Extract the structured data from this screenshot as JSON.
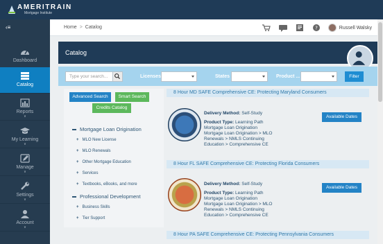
{
  "brand": {
    "name": "AMERITRAIN",
    "tagline": "Mortgage Institute"
  },
  "breadcrumb": {
    "home": "Home",
    "separator": ">",
    "current": "Catalog"
  },
  "header": {
    "notifications": [
      {
        "icon": "cart-icon",
        "badge": ""
      },
      {
        "icon": "message-icon",
        "badge": ""
      },
      {
        "icon": "notes-icon",
        "badge": ""
      },
      {
        "icon": "help-icon",
        "badge": ""
      }
    ],
    "user_name": "Russell Walsky"
  },
  "sidebar": {
    "items": [
      {
        "label": "Dashboard",
        "icon": "dashboard-icon",
        "active": false
      },
      {
        "label": "Catalog",
        "icon": "catalog-icon",
        "active": true
      },
      {
        "label": "Reports",
        "icon": "reports-icon",
        "active": false
      },
      {
        "label": "My Learning",
        "icon": "graduation-cap-icon",
        "active": false
      },
      {
        "label": "Manage",
        "icon": "edit-icon",
        "active": false
      },
      {
        "label": "Settings",
        "icon": "wrench-icon",
        "active": false
      },
      {
        "label": "Account",
        "icon": "user-icon",
        "active": false
      }
    ]
  },
  "page": {
    "title": "Catalog"
  },
  "filters": {
    "search_placeholder": "Type your search...",
    "licenses_label": "Licenses",
    "states_label": "States",
    "product_label": "Product ...",
    "filter_button": "Filter"
  },
  "left_panel": {
    "advanced_search": "Advanced Search",
    "smart_search": "Smart Search",
    "credits_catalog": "Credits Catalog",
    "categories": [
      {
        "label": "Mortgage Loan Origination",
        "children": [
          "MLO New License",
          "MLO Renewals",
          "Other Mortgage Education",
          "Services",
          "Textbooks, eBooks, and more"
        ]
      },
      {
        "label": "Professional Development",
        "children": [
          "Business Skills",
          "Tier Support"
        ]
      }
    ]
  },
  "courses": [
    {
      "title": "8 Hour MD SAFE Comprehensive CE: Protecting Maryland Consumers",
      "delivery_label": "Delivery Method:",
      "delivery": "Self-Study",
      "product_label": "Product Type:",
      "product_type": "Learning Path",
      "categories": [
        "Mortgage Loan Origination",
        "Mortgage Loan Origination > MLO",
        "Renewals > NMLS Continuing",
        "Education > Comprehensive CE"
      ],
      "button": "Available Dates"
    },
    {
      "title": "8 Hour FL SAFE Comprehensive CE: Protecting Florida Consumers",
      "delivery_label": "Delivery Method:",
      "delivery": "Self-Study",
      "product_label": "Product Type:",
      "product_type": "Learning Path",
      "categories": [
        "Mortgage Loan Origination",
        "Mortgage Loan Origination > MLO",
        "Renewals > NMLS Continuing",
        "Education > Comprehensive CE"
      ],
      "button": "Available Dates"
    },
    {
      "title": "8 Hour PA SAFE Comprehensive CE: Protecting Pennsylvania Consumers"
    }
  ],
  "colors": {
    "header": "#1f3b57",
    "accent": "#2383c6",
    "green": "#5cb85c",
    "active_nav": "#0f7fc1"
  }
}
